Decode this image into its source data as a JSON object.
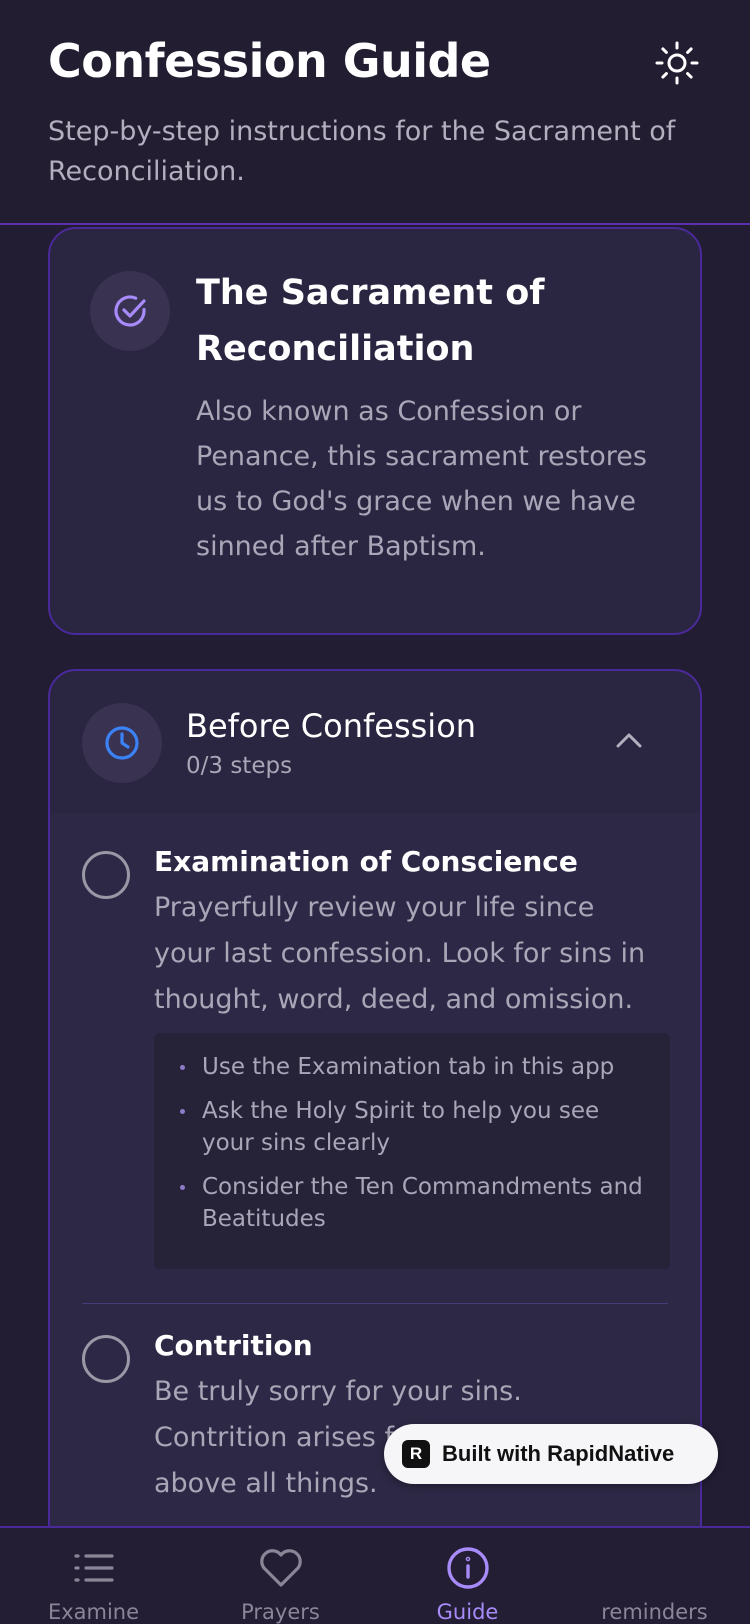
{
  "header": {
    "title": "Confession Guide",
    "subtitle": "Step-by-step instructions for the Sacrament of Reconciliation.",
    "theme_icon": "sun-icon"
  },
  "intro": {
    "icon": "check-circle-icon",
    "title": "The Sacrament of Reconciliation",
    "text": "Also known as Confession or Penance, this sacrament restores us to God's grace when we have sinned after Baptism."
  },
  "section": {
    "icon": "clock-icon",
    "title": "Before Confession",
    "progress": "0/3 steps",
    "expanded": true,
    "steps": [
      {
        "title": "Examination of Conscience",
        "description": "Prayerfully review your life since your last confession. Look for sins in thought, word, deed, and omission.",
        "completed": false,
        "tips": [
          "Use the Examination tab in this app",
          "Ask the Holy Spirit to help you see your sins clearly",
          "Consider the Ten Commandments and Beatitudes"
        ]
      },
      {
        "title": "Contrition",
        "description": "Be truly sorry for your sins. Contrition arises from love of God above all things.",
        "completed": false
      }
    ]
  },
  "tabbar": {
    "tabs": [
      {
        "label": "Examine",
        "icon": "list-icon",
        "active": false
      },
      {
        "label": "Prayers",
        "icon": "heart-icon",
        "active": false
      },
      {
        "label": "Guide",
        "icon": "info-icon",
        "active": true
      },
      {
        "label": "reminders",
        "icon": "bell-icon",
        "active": false
      }
    ]
  },
  "badge": {
    "logo": "R",
    "text": "Built with RapidNative"
  },
  "colors": {
    "background": "#221d33",
    "card": "#2a2540",
    "card_border": "#4a2a9a",
    "accent": "#a78bfa",
    "clock_blue": "#3b82f6",
    "muted_text": "#aaa6b8"
  }
}
